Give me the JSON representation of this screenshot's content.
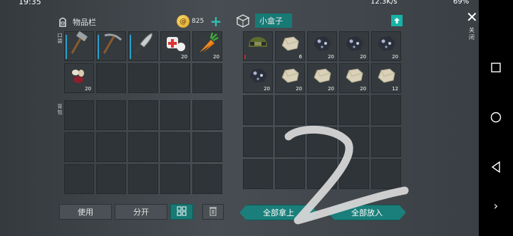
{
  "status": {
    "time": "19:35",
    "network": "12.3K/s",
    "battery": "69%"
  },
  "inventory": {
    "title": "物品栏",
    "coins": "825",
    "hotbar_label": "口袋",
    "backpack_label": "背包",
    "hotbar": [
      {
        "icon": "hammer-icon",
        "count": "",
        "durability": true
      },
      {
        "icon": "pickaxe-icon",
        "count": "",
        "durability": true
      },
      {
        "icon": "machete-icon",
        "count": "",
        "durability": true
      },
      {
        "icon": "bandage-icon",
        "count": "20"
      },
      {
        "icon": "carrot-icon",
        "count": "20"
      },
      {
        "icon": "seeds-icon",
        "count": "20"
      },
      {
        "icon": "",
        "count": ""
      },
      {
        "icon": "",
        "count": ""
      },
      {
        "icon": "",
        "count": ""
      },
      {
        "icon": "",
        "count": ""
      }
    ],
    "buttons": {
      "use": "使用",
      "split": "分开"
    }
  },
  "container": {
    "title": "小盒子",
    "close_label": "关闭",
    "slots": [
      {
        "icon": "helmet-icon",
        "count": "",
        "durability": "red"
      },
      {
        "icon": "stone-icon",
        "count": "6"
      },
      {
        "icon": "iron-ore-icon",
        "count": "20"
      },
      {
        "icon": "iron-ore-icon",
        "count": "20"
      },
      {
        "icon": "iron-ore-icon",
        "count": "20"
      },
      {
        "icon": "iron-ore-icon",
        "count": "20"
      },
      {
        "icon": "stone-icon",
        "count": "20"
      },
      {
        "icon": "stone-icon",
        "count": "20"
      },
      {
        "icon": "stone-icon",
        "count": "20"
      },
      {
        "icon": "stone-icon",
        "count": "12"
      }
    ],
    "buttons": {
      "take_all": "全部拿上",
      "put_all": "全部放入"
    }
  },
  "overlay": {
    "handwritten": "2"
  },
  "colors": {
    "accent": "#177a75",
    "durability": "#2c9fc8",
    "warning": "#c62828"
  }
}
